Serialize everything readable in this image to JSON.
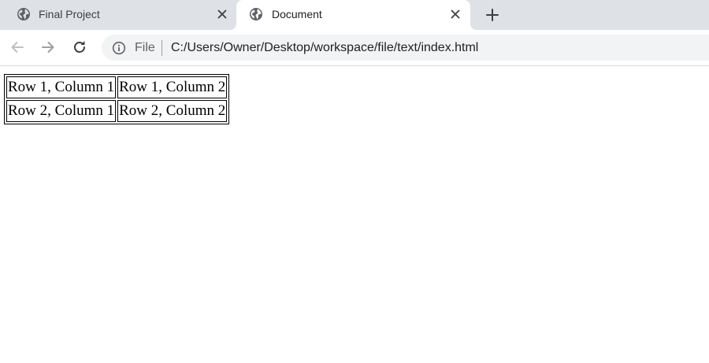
{
  "tabs": [
    {
      "title": "Final Project",
      "favicon": "globe-icon",
      "active": false
    },
    {
      "title": "Document",
      "favicon": "globe-icon",
      "active": true
    }
  ],
  "toolbar": {
    "back_icon": "back-arrow-icon",
    "forward_icon": "forward-arrow-icon",
    "reload_icon": "reload-icon"
  },
  "omnibox": {
    "info_icon": "info-icon",
    "scheme": "File",
    "url": "C:/Users/Owner/Desktop/workspace/file/text/index.html"
  },
  "content": {
    "table": {
      "rows": [
        [
          "Row 1, Column 1",
          "Row 1, Column 2"
        ],
        [
          "Row 2, Column 1",
          "Row 2, Column 2"
        ]
      ]
    }
  },
  "colors": {
    "tabstrip_bg": "#dee1e6",
    "omnibox_bg": "#f1f3f4",
    "icon_color": "#5f6368",
    "disabled_icon_color": "#9aa0a6"
  }
}
